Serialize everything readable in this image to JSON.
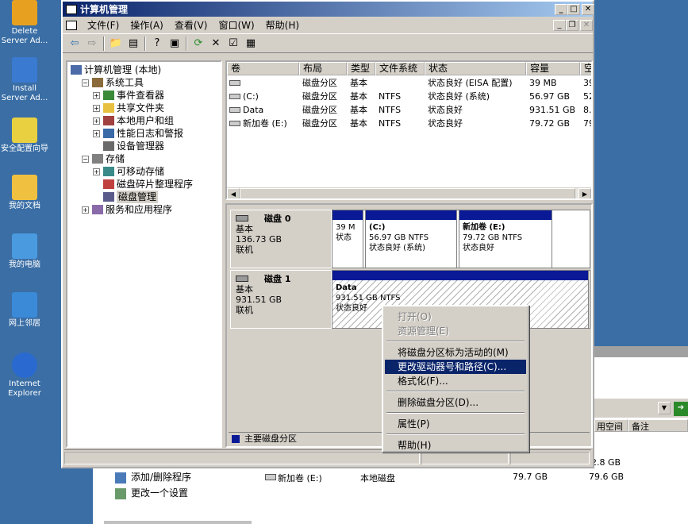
{
  "desktop": {
    "icons": [
      {
        "label1": "Delete",
        "label2": "Server Ad...",
        "icon": "delete-server-icon"
      },
      {
        "label1": "Install",
        "label2": "Server Ad...",
        "icon": "install-server-icon"
      },
      {
        "label1": "安全配置向导",
        "label2": "",
        "icon": "security-wizard-icon"
      },
      {
        "label1": "我的文档",
        "label2": "",
        "icon": "my-documents-icon"
      },
      {
        "label1": "我的电脑",
        "label2": "",
        "icon": "my-computer-icon"
      },
      {
        "label1": "网上邻居",
        "label2": "",
        "icon": "network-icon"
      },
      {
        "label1": "Internet",
        "label2": "Explorer",
        "icon": "ie-icon"
      }
    ]
  },
  "bg": {
    "col_free": "用空间",
    "col_note": "备注",
    "row_name": "新加卷 (E:)",
    "row_type": "本地磁盘",
    "row_size": "79.7 GB",
    "row_free": "79.6 GB",
    "prev_free": "2.8 GB",
    "task1": "添加/删除程序",
    "task2": "更改一个设置"
  },
  "window": {
    "title": "计算机管理"
  },
  "menu": [
    "文件(F)",
    "操作(A)",
    "查看(V)",
    "窗口(W)",
    "帮助(H)"
  ],
  "tree": [
    {
      "label": "计算机管理 (本地)",
      "level": 0,
      "expander": "",
      "icon": "computer-mgmt-icon"
    },
    {
      "label": "系统工具",
      "level": 1,
      "expander": "-",
      "icon": "tools-icon"
    },
    {
      "label": "事件查看器",
      "level": 2,
      "expander": "+",
      "icon": "event-viewer-icon"
    },
    {
      "label": "共享文件夹",
      "level": 2,
      "expander": "+",
      "icon": "shared-folder-icon"
    },
    {
      "label": "本地用户和组",
      "level": 2,
      "expander": "+",
      "icon": "users-icon"
    },
    {
      "label": "性能日志和警报",
      "level": 2,
      "expander": "+",
      "icon": "perf-icon"
    },
    {
      "label": "设备管理器",
      "level": 2,
      "expander": "",
      "icon": "device-manager-icon"
    },
    {
      "label": "存储",
      "level": 1,
      "expander": "-",
      "icon": "storage-icon"
    },
    {
      "label": "可移动存储",
      "level": 2,
      "expander": "+",
      "icon": "removable-storage-icon"
    },
    {
      "label": "磁盘碎片整理程序",
      "level": 2,
      "expander": "",
      "icon": "defrag-icon"
    },
    {
      "label": "磁盘管理",
      "level": 2,
      "expander": "",
      "icon": "disk-mgmt-icon",
      "selected": true
    },
    {
      "label": "服务和应用程序",
      "level": 1,
      "expander": "+",
      "icon": "services-icon"
    }
  ],
  "volumes": {
    "headers": [
      "卷",
      "布局",
      "类型",
      "文件系统",
      "状态",
      "容量",
      "空"
    ],
    "rows": [
      [
        "",
        "磁盘分区",
        "基本",
        "",
        "状态良好 (EISA 配置)",
        "39 MB",
        "39"
      ],
      [
        "(C:)",
        "磁盘分区",
        "基本",
        "NTFS",
        "状态良好 (系统)",
        "56.97 GB",
        "52"
      ],
      [
        "Data",
        "磁盘分区",
        "基本",
        "NTFS",
        "状态良好",
        "931.51 GB",
        "8."
      ],
      [
        "新加卷 (E:)",
        "磁盘分区",
        "基本",
        "NTFS",
        "状态良好",
        "79.72 GB",
        "79"
      ]
    ]
  },
  "disks": [
    {
      "name": "磁盘 0",
      "type": "基本",
      "size": "136.73 GB",
      "status": "联机",
      "parts": [
        {
          "title": "",
          "line1": "39 M",
          "line2": "状态"
        },
        {
          "title": "(C:)",
          "line1": "56.97 GB NTFS",
          "line2": "状态良好 (系统)"
        },
        {
          "title": "新加卷 (E:)",
          "line1": "79.72 GB NTFS",
          "line2": "状态良好"
        }
      ]
    },
    {
      "name": "磁盘 1",
      "type": "基本",
      "size": "931.51 GB",
      "status": "联机",
      "parts": [
        {
          "title": "Data",
          "line1": "931.51 GB NTFS",
          "line2": "状态良好"
        }
      ]
    }
  ],
  "legend": {
    "label": "主要磁盘分区",
    "color": "#0a1a96"
  },
  "context_menu": [
    {
      "label": "打开(O)",
      "disabled": true
    },
    {
      "label": "资源管理(E)",
      "disabled": true
    },
    {
      "sep": true
    },
    {
      "label": "将磁盘分区标为活动的(M)"
    },
    {
      "label": "更改驱动器号和路径(C)...",
      "selected": true
    },
    {
      "label": "格式化(F)..."
    },
    {
      "sep": true
    },
    {
      "label": "删除磁盘分区(D)..."
    },
    {
      "sep": true
    },
    {
      "label": "属性(P)"
    },
    {
      "sep": true
    },
    {
      "label": "帮助(H)"
    }
  ]
}
